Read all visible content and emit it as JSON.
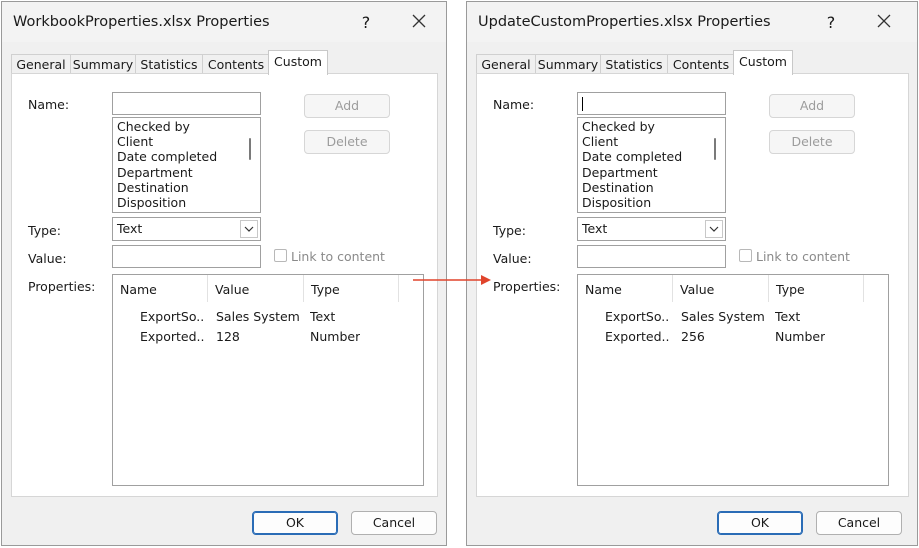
{
  "left": {
    "title": "WorkbookProperties.xlsx Properties",
    "help": "?",
    "tabs": [
      {
        "label": "General"
      },
      {
        "label": "Summary"
      },
      {
        "label": "Statistics"
      },
      {
        "label": "Contents"
      },
      {
        "label": "Custom",
        "active": true
      }
    ],
    "name_label": "Name:",
    "name_value": "",
    "add_label": "Add",
    "delete_label": "Delete",
    "name_options": [
      "Checked by",
      "Client",
      "Date completed",
      "Department",
      "Destination",
      "Disposition"
    ],
    "type_label": "Type:",
    "type_value": "Text",
    "value_label": "Value:",
    "link_label": "Link to content",
    "properties_label": "Properties:",
    "columns": [
      "Name",
      "Value",
      "Type"
    ],
    "rows": [
      {
        "name": "ExportSo...",
        "value": "Sales System",
        "type": "Text"
      },
      {
        "name": "Exported...",
        "value": "128",
        "type": "Number"
      }
    ],
    "ok_label": "OK",
    "cancel_label": "Cancel"
  },
  "right": {
    "title": "UpdateCustomProperties.xlsx Properties",
    "help": "?",
    "tabs": [
      {
        "label": "General"
      },
      {
        "label": "Summary"
      },
      {
        "label": "Statistics"
      },
      {
        "label": "Contents"
      },
      {
        "label": "Custom",
        "active": true
      }
    ],
    "name_label": "Name:",
    "name_value": "",
    "add_label": "Add",
    "delete_label": "Delete",
    "name_options": [
      "Checked by",
      "Client",
      "Date completed",
      "Department",
      "Destination",
      "Disposition"
    ],
    "type_label": "Type:",
    "type_value": "Text",
    "value_label": "Value:",
    "link_label": "Link to content",
    "properties_label": "Properties:",
    "columns": [
      "Name",
      "Value",
      "Type"
    ],
    "rows": [
      {
        "name": "ExportSo...",
        "value": "Sales System",
        "type": "Text"
      },
      {
        "name": "Exported...",
        "value": "256",
        "type": "Number"
      }
    ],
    "ok_label": "OK",
    "cancel_label": "Cancel"
  },
  "colors": {
    "arrow": "#e0442c",
    "default_button_border": "#2a6cb6"
  },
  "icons": {
    "close": "close-icon",
    "dropdown": "chevron-down-icon",
    "arrow": "arrow-right-icon"
  }
}
